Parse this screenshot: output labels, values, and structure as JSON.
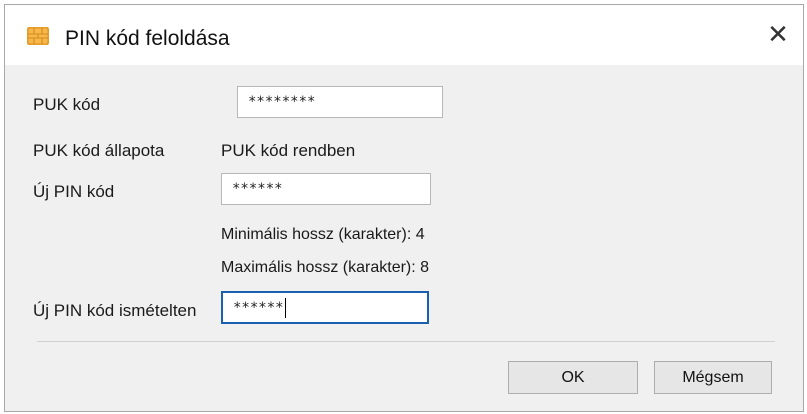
{
  "window": {
    "title": "PIN kód feloldása",
    "icon": "smart-card-chip-icon",
    "close_glyph": "✕"
  },
  "form": {
    "puk_label": "PUK kód",
    "puk_value": "********",
    "puk_status_label": "PUK kód állapota",
    "puk_status_value": "PUK kód rendben",
    "new_pin_label": "Új PIN kód",
    "new_pin_value": "******",
    "min_length_text": "Minimális hossz (karakter): 4",
    "max_length_text": "Maximális hossz (karakter): 8",
    "repeat_pin_label": "Új PIN kód ismételten",
    "repeat_pin_value": "******"
  },
  "buttons": {
    "ok_label": "OK",
    "cancel_label": "Mégsem"
  },
  "colors": {
    "icon_orange": "#f0a030",
    "focus_border": "#1a5fb0",
    "dialog_bg": "#f0f0f0"
  }
}
